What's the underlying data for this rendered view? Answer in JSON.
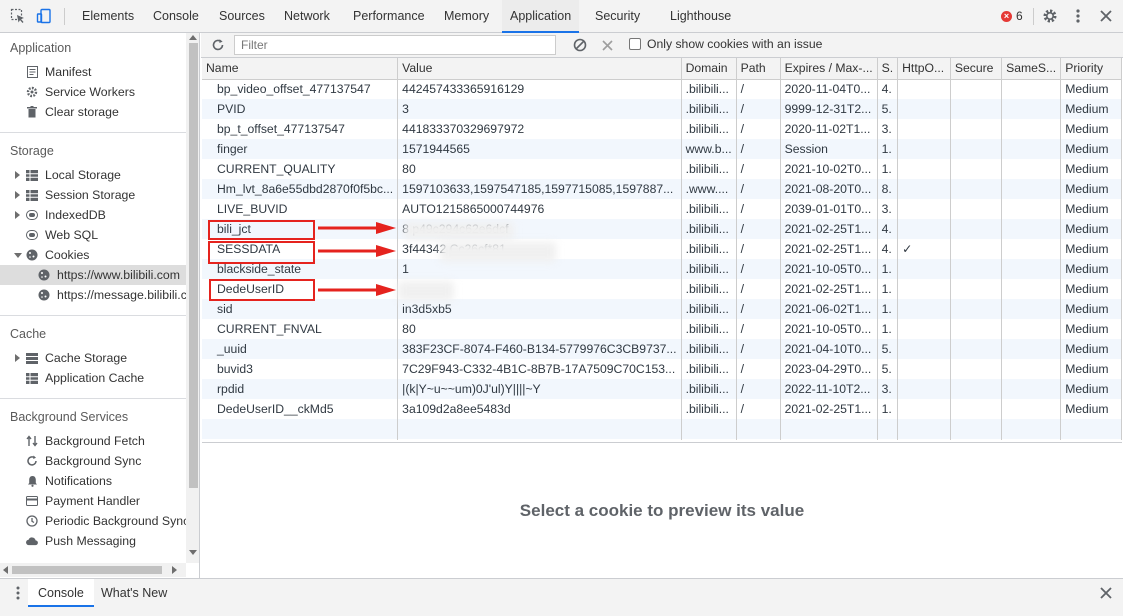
{
  "toolbar": {
    "tabs": [
      "Elements",
      "Console",
      "Sources",
      "Network",
      "Performance",
      "Memory",
      "Application",
      "Security",
      "Lighthouse"
    ],
    "active_tab": "Application",
    "error_count": "6"
  },
  "sidebar": {
    "sections": {
      "application": "Application",
      "storage": "Storage",
      "cache": "Cache",
      "background": "Background Services"
    },
    "application_items": [
      "Manifest",
      "Service Workers",
      "Clear storage"
    ],
    "storage_items": [
      "Local Storage",
      "Session Storage",
      "IndexedDB",
      "Web SQL",
      "Cookies"
    ],
    "cookie_origins": [
      "https://www.bilibili.com",
      "https://message.bilibili.com"
    ],
    "cache_items": [
      "Cache Storage",
      "Application Cache"
    ],
    "background_items": [
      "Background Fetch",
      "Background Sync",
      "Notifications",
      "Payment Handler",
      "Periodic Background Sync",
      "Push Messaging"
    ]
  },
  "cookie_toolbar": {
    "filter_placeholder": "Filter",
    "only_issue_label": "Only show cookies with an issue"
  },
  "table": {
    "columns": [
      "Name",
      "Value",
      "Domain",
      "Path",
      "Expires / Max-...",
      "S.",
      "HttpO...",
      "Secure",
      "SameS...",
      "Priority"
    ],
    "rows": [
      [
        "bp_video_offset_477137547",
        "442457433365916129",
        ".bilibili...",
        "/",
        "2020-11-04T0...",
        "4.",
        "",
        "",
        "",
        "Medium"
      ],
      [
        "PVID",
        "3",
        ".bilibili...",
        "/",
        "9999-12-31T2...",
        "5.",
        "",
        "",
        "",
        "Medium"
      ],
      [
        "bp_t_offset_477137547",
        "441833370329697972",
        ".bilibili...",
        "/",
        "2020-11-02T1...",
        "3.",
        "",
        "",
        "",
        "Medium"
      ],
      [
        "finger",
        "1571944565",
        "www.b...",
        "/",
        "Session",
        "1.",
        "",
        "",
        "",
        "Medium"
      ],
      [
        "CURRENT_QUALITY",
        "80",
        ".bilibili...",
        "/",
        "2021-10-02T0...",
        "1.",
        "",
        "",
        "",
        "Medium"
      ],
      [
        "Hm_lvt_8a6e55dbd2870f0f5bc...",
        "1597103633,1597547185,1597715085,1597887...",
        ".www....",
        "/",
        "2021-08-20T0...",
        "8.",
        "",
        "",
        "",
        "Medium"
      ],
      [
        "LIVE_BUVID",
        "AUTO1215865000744976",
        ".bilibili...",
        "/",
        "2039-01-01T0...",
        "3.",
        "",
        "",
        "",
        "Medium"
      ],
      [
        "bili_jct",
        "8                    p49c294c62e6dcf",
        ".bilibili...",
        "/",
        "2021-02-25T1...",
        "4.",
        "",
        "",
        "",
        "Medium"
      ],
      [
        "SESSDATA",
        "3f44342                         Cc26cf*81",
        ".bilibili...",
        "/",
        "2021-02-25T1...",
        "4.",
        "✓",
        "",
        "",
        "Medium"
      ],
      [
        "blackside_state",
        "1",
        ".bilibili...",
        "/",
        "2021-10-05T0...",
        "1.",
        "",
        "",
        "",
        "Medium"
      ],
      [
        "DedeUserID",
        "",
        ".bilibili...",
        "/",
        "2021-02-25T1...",
        "1.",
        "",
        "",
        "",
        "Medium"
      ],
      [
        "sid",
        "in3d5xb5",
        ".bilibili...",
        "/",
        "2021-06-02T1...",
        "1.",
        "",
        "",
        "",
        "Medium"
      ],
      [
        "CURRENT_FNVAL",
        "80",
        ".bilibili...",
        "/",
        "2021-10-05T0...",
        "1.",
        "",
        "",
        "",
        "Medium"
      ],
      [
        "_uuid",
        "383F23CF-8074-F460-B134-5779976C3CB9737...",
        ".bilibili...",
        "/",
        "2021-04-10T0...",
        "5.",
        "",
        "",
        "",
        "Medium"
      ],
      [
        "buvid3",
        "7C29F943-C332-4B1C-8B7B-17A7509C70C153...",
        ".bilibili...",
        "/",
        "2023-04-29T0...",
        "5.",
        "",
        "",
        "",
        "Medium"
      ],
      [
        "rpdid",
        "|(k|Y~u~~um)0J'ul)Y||||~Y",
        ".bilibili...",
        "/",
        "2022-11-10T2...",
        "3.",
        "",
        "",
        "",
        "Medium"
      ],
      [
        "DedeUserID__ckMd5",
        "3a109d2a8ee5483d",
        ".bilibili...",
        "/",
        "2021-02-25T1...",
        "1.",
        "",
        "",
        "",
        "Medium"
      ]
    ]
  },
  "preview": {
    "message": "Select a cookie to preview its value"
  },
  "drawer": {
    "tabs": [
      "Console",
      "What's New"
    ],
    "active_tab": "Console"
  },
  "colors": {
    "accent": "#1a73e8",
    "annotation": "#e5231e",
    "error": "#e53935"
  }
}
